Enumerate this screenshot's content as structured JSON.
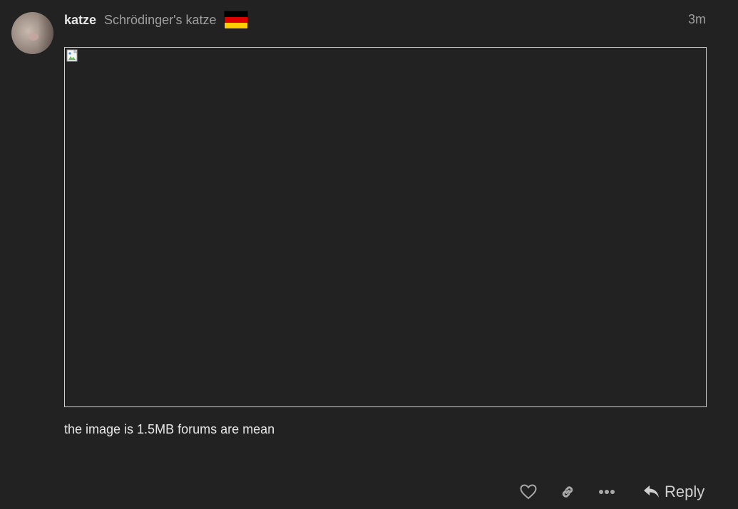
{
  "post": {
    "username": "katze",
    "user_title": "Schrödinger's katze",
    "flag_colors": [
      "#000000",
      "#DD0000",
      "#FFCE00"
    ],
    "timestamp": "3m",
    "image": {
      "state": "broken-image"
    },
    "text": "the image is 1.5MB forums are mean"
  },
  "actions": {
    "like_icon": "heart-icon",
    "link_icon": "link-icon",
    "more_icon": "ellipsis-icon",
    "reply_icon": "reply-arrow-icon",
    "reply_label": "Reply"
  },
  "colors": {
    "background": "#222222",
    "text": "#dddddd",
    "muted": "#9f9f9f",
    "image_border": "#cfcfcf"
  }
}
